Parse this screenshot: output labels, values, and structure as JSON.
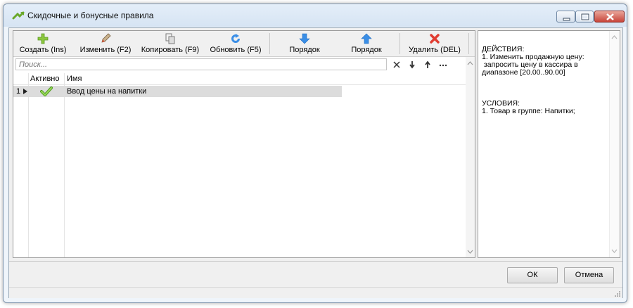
{
  "window": {
    "title": "Скидочные и бонусные правила"
  },
  "toolbar": {
    "create_label": "Создать (Ins)",
    "edit_label": "Изменить (F2)",
    "copy_label": "Копировать (F9)",
    "refresh_label": "Обновить (F5)",
    "order_down_label": "Порядок",
    "order_up_label": "Порядок",
    "delete_label": "Удалить (DEL)"
  },
  "search": {
    "placeholder": "Поиск..."
  },
  "grid": {
    "columns": [
      "Активно",
      "Имя"
    ],
    "rows": [
      {
        "index": "1",
        "active": true,
        "name": "Ввод цены на напитки"
      }
    ]
  },
  "details": {
    "actions_header": "ДЕЙСТВИЯ:",
    "actions_lines": [
      "1. Изменить продажную цену:",
      " запросить цену в кассира в",
      "диапазоне [20.00..90.00]"
    ],
    "conditions_header": "УСЛОВИЯ:",
    "conditions_lines": [
      "1. Товар в группе: Напитки;"
    ]
  },
  "buttons": {
    "ok": "ОК",
    "cancel": "Отмена"
  },
  "colors": {
    "accent_green": "#8cc63f",
    "arrow_blue": "#3a8ee6",
    "delete_red": "#e03c31",
    "row_selected": "#dcdcdc"
  }
}
